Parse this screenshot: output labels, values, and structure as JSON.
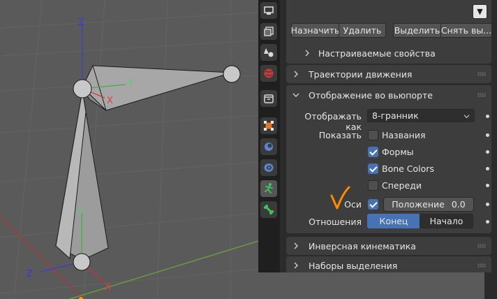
{
  "viewport": {
    "axis_labels": {
      "bone1_y": "Y",
      "bone1_x": "X",
      "bone2_y": "Y",
      "bone2_x": "X",
      "bone2_z": "Z"
    },
    "annotation_mark": "checkmark",
    "annotation_color": "#ff8a00"
  },
  "tabs": [
    {
      "icon": "output-icon",
      "active": false
    },
    {
      "icon": "view-layer-icon",
      "active": false
    },
    {
      "icon": "scene-icon",
      "active": false
    },
    {
      "icon": "world-icon",
      "active": false
    },
    {
      "icon": "collection-icon",
      "active": false
    },
    {
      "icon": "object-icon",
      "active": false
    },
    {
      "icon": "modifier-icon",
      "active": false
    },
    {
      "icon": "physics-icon",
      "active": false
    },
    {
      "icon": "armature-data-icon",
      "active": true
    },
    {
      "icon": "bone-icon",
      "active": false
    }
  ],
  "bone_groups": {
    "dropdown_glyph": "▼",
    "buttons": {
      "assign": "Назначить",
      "remove": "Удалить",
      "select": "Выделить",
      "deselect": "Снять вы..."
    },
    "custom_props": "Настраиваемые свойства"
  },
  "sections": {
    "motion_paths": "Траектории движения",
    "viewport_display": "Отображение во вьюпорте",
    "ik": "Инверсная кинематика",
    "selection_sets": "Наборы выделения"
  },
  "viewport_display": {
    "display_as_label": "Отображать как",
    "display_as_value": "8-гранник",
    "show_label": "Показать",
    "checkboxes": [
      {
        "label": "Названия",
        "checked": false
      },
      {
        "label": "Формы",
        "checked": true
      },
      {
        "label": "Bone Colors",
        "checked": true
      },
      {
        "label": "Спереди",
        "checked": false
      }
    ],
    "axes_label": "Оси",
    "axes_checked": true,
    "position_label": "Положение",
    "position_value": "0.0",
    "relations_label": "Отношения",
    "relations_options": [
      "Конец",
      "Начало"
    ],
    "relations_selected": "Конец"
  }
}
